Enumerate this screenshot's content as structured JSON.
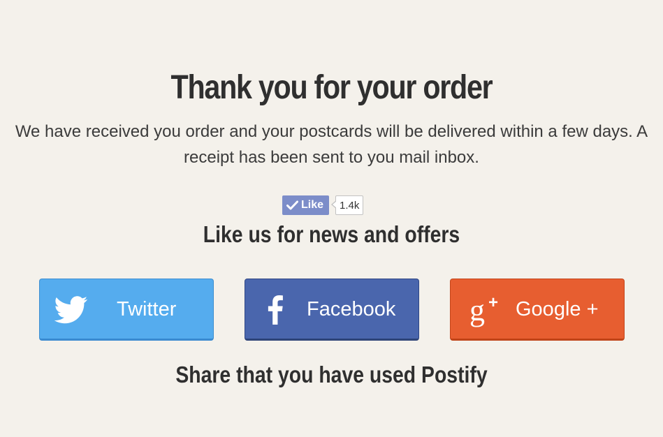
{
  "confirmation": {
    "title": "Thank you for your order",
    "message": "We have received you order and your postcards will be delivered within a few days. A receipt has been sent to you mail inbox."
  },
  "like_widget": {
    "label": "Like",
    "count": "1.4k",
    "icon": "check-icon"
  },
  "like_heading": "Like us for news and offers",
  "share_buttons": [
    {
      "label": "Twitter",
      "icon": "twitter-bird-icon",
      "color": "#55acee"
    },
    {
      "label": "Facebook",
      "icon": "facebook-f-icon",
      "color": "#4a66ad"
    },
    {
      "label": "Google +",
      "icon": "google-plus-icon",
      "color": "#e75e30"
    }
  ],
  "share_caption": "Share that you have used Postify",
  "colors": {
    "background": "#f4f1eb",
    "text": "#333333",
    "like_button": "#7c8dc9"
  }
}
